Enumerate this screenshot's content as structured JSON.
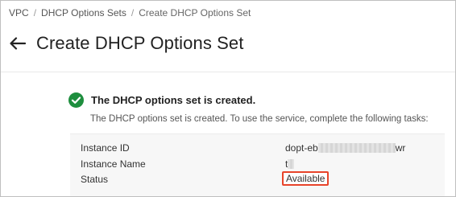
{
  "breadcrumb": {
    "items": [
      "VPC",
      "DHCP Options Sets",
      "Create DHCP Options Set"
    ],
    "separator": "/"
  },
  "header": {
    "title": "Create DHCP Options Set",
    "back_icon": "arrow-left-icon"
  },
  "result": {
    "icon": "check-circle-icon",
    "icon_color": "#1e8e3e",
    "title": "The DHCP options set is created.",
    "description": "The DHCP options set is created. To use the service, complete the following tasks:"
  },
  "details": {
    "rows": [
      {
        "label": "Instance ID",
        "value_prefix": "dopt-eb",
        "value_suffix": "wr"
      },
      {
        "label": "Instance Name",
        "value_prefix": "t",
        "value_suffix": ""
      },
      {
        "label": "Status",
        "value": "Available"
      }
    ],
    "highlight_color": "#e8442a"
  }
}
